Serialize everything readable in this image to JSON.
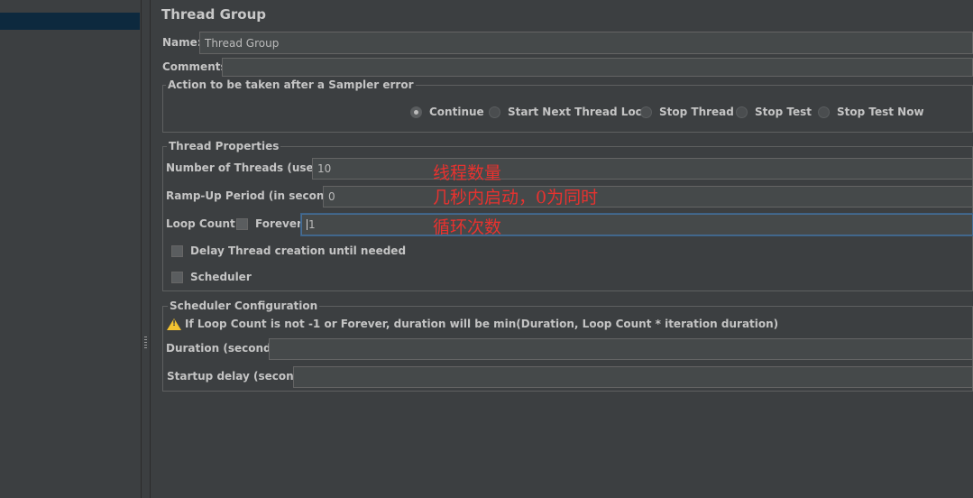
{
  "title": "Thread Group",
  "name": {
    "label": "Name:",
    "value": "Thread Group"
  },
  "comments": {
    "label": "Comments:",
    "value": ""
  },
  "sampler_error": {
    "legend": "Action to be taken after a Sampler error",
    "options": [
      "Continue",
      "Start Next Thread Loop",
      "Stop Thread",
      "Stop Test",
      "Stop Test Now"
    ],
    "selected": "Continue"
  },
  "thread_properties": {
    "legend": "Thread Properties",
    "num_threads_label": "Number of Threads (users):",
    "num_threads_value": "10",
    "rampup_label": "Ramp-Up Period (in seconds):",
    "rampup_value": "0",
    "loop_label": "Loop Count:",
    "forever_label": "Forever",
    "loop_value": "1",
    "delay_label": "Delay Thread creation until needed",
    "scheduler_label": "Scheduler"
  },
  "annotations": {
    "threads": "线程数量",
    "rampup": "几秒内启动，0为同时",
    "loop": "循环次数"
  },
  "scheduler_config": {
    "legend": "Scheduler Configuration",
    "warning": "If Loop Count is not -1 or Forever, duration will be min(Duration, Loop Count * iteration duration)",
    "duration_label": "Duration (seconds)",
    "duration_value": "",
    "startup_label": "Startup delay (seconds)",
    "startup_value": ""
  },
  "colors": {
    "background": "#3c3f41",
    "selection": "#0d293e",
    "annotation": "#e8322f",
    "warning": "#f3c331"
  }
}
